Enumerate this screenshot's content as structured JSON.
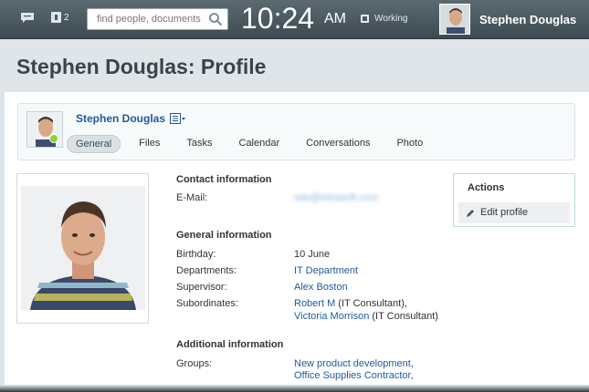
{
  "topbar": {
    "notification_count": "2",
    "search_placeholder": "find people, documents",
    "time": "10:24",
    "ampm": "AM",
    "status": "Working",
    "user_name": "Stephen Douglas"
  },
  "page": {
    "title": "Stephen Douglas: Profile"
  },
  "profile": {
    "name": "Stephen Douglas",
    "tabs": [
      "General",
      "Files",
      "Tasks",
      "Calendar",
      "Conversations",
      "Photo"
    ],
    "active_tab": "General"
  },
  "contact": {
    "title": "Contact information",
    "email_label": "E-Mail:",
    "email_value": "sdo@intrasoft.com"
  },
  "general": {
    "title": "General information",
    "birthday_label": "Birthday:",
    "birthday_value": "10 June",
    "departments_label": "Departments:",
    "departments_value": "IT Department",
    "supervisor_label": "Supervisor:",
    "supervisor_value": "Alex Boston",
    "subordinates_label": "Subordinates:",
    "subordinates": [
      {
        "name": "Robert M",
        "role": " (IT Consultant),"
      },
      {
        "name": "Victoria Morrison",
        "role": " (IT Consultant)"
      }
    ]
  },
  "additional": {
    "title": "Additional information",
    "groups_label": "Groups:",
    "groups": [
      "New product development,",
      "Office Supplies Contractor,"
    ]
  },
  "actions": {
    "title": "Actions",
    "edit_profile": "Edit profile"
  },
  "colors": {
    "link": "#1f5a9a",
    "topbar": "#4a5860",
    "online": "#8ccf38"
  }
}
